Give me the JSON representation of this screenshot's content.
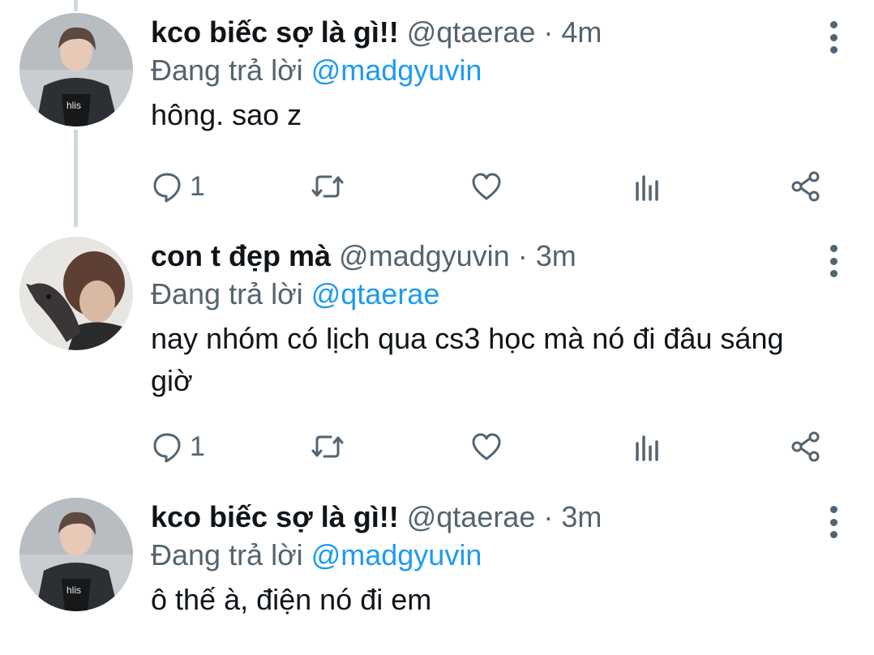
{
  "tweets": [
    {
      "name": "kco biếc sợ là gì!!",
      "handle": "@qtaerae",
      "separator": "·",
      "time": "4m",
      "reply_prefix": "Đang trả lời",
      "reply_to": "@madgyuvin",
      "text": "hông. sao z",
      "reply_count": "1",
      "avatar": "avatar-person-dark-jacket"
    },
    {
      "name": "con t đẹp mà",
      "handle": "@madgyuvin",
      "separator": "·",
      "time": "3m",
      "reply_prefix": "Đang trả lời",
      "reply_to": "@qtaerae",
      "text": "nay nhóm có lịch qua cs3 học mà nó đi đâu sáng giờ",
      "reply_count": "1",
      "avatar": "avatar-person-with-dog"
    },
    {
      "name": "kco biếc sợ là gì!!",
      "handle": "@qtaerae",
      "separator": "·",
      "time": "3m",
      "reply_prefix": "Đang trả lời",
      "reply_to": "@madgyuvin",
      "text": "ô thế à, điện nó đi em",
      "reply_count": "",
      "avatar": "avatar-person-dark-jacket"
    }
  ],
  "icons": {
    "reply": "reply-icon",
    "retweet": "retweet-icon",
    "like": "heart-icon",
    "stats": "analytics-icon",
    "share": "share-icon",
    "more": "more-vertical-icon"
  },
  "colors": {
    "text": "#0f1419",
    "secondary": "#536471",
    "link": "#1d9bf0",
    "thread_line": "#cfd9de",
    "background": "#ffffff"
  }
}
